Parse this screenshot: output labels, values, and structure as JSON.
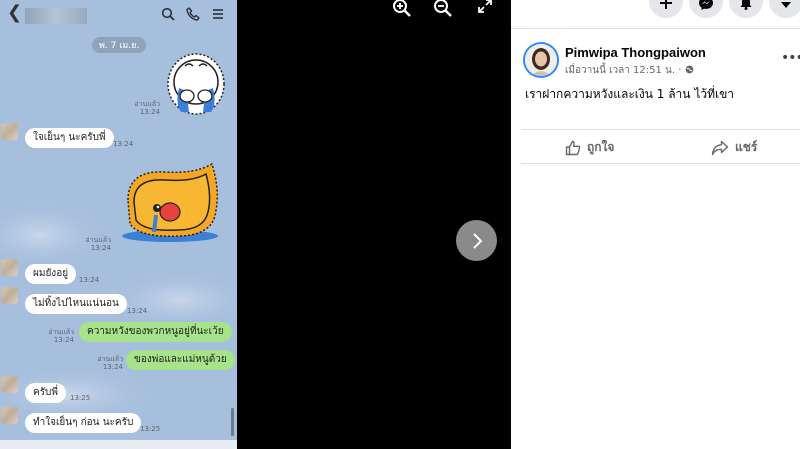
{
  "chat": {
    "date_pill": "พ. 7 เม.ย.",
    "messages": [
      {
        "side": "right",
        "kind": "sticker",
        "read": "อ่านแล้ว",
        "time": "13:24"
      },
      {
        "side": "left",
        "kind": "text",
        "text": "ใจเย็นๆ นะครับพี่",
        "time": "13:24"
      },
      {
        "side": "right",
        "kind": "sticker",
        "read": "อ่านแล้ว",
        "time": "13:24"
      },
      {
        "side": "left",
        "kind": "text",
        "text": "ผมยังอยู่",
        "time": "13:24"
      },
      {
        "side": "left",
        "kind": "text",
        "text": "ไม่ทิ้งไปไหนแน่นอน",
        "time": "13:24"
      },
      {
        "side": "right",
        "kind": "text",
        "text": "ความหวังของพวกหนูอยู่ที่นะเว้ย",
        "read": "อ่านแล้ว",
        "time": "13:24"
      },
      {
        "side": "right",
        "kind": "text",
        "text": "ของพ่อและแม่หนูด้วย",
        "read": "อ่านแล้ว",
        "time": "13:24"
      },
      {
        "side": "left",
        "kind": "text",
        "text": "ครับพี่",
        "time": "13:25"
      },
      {
        "side": "left",
        "kind": "text",
        "text": "ทำใจเย็นๆ ก่อน นะครับ",
        "time": "13:25"
      }
    ],
    "icons": [
      "back-icon",
      "search-icon",
      "phone-icon",
      "menu-icon"
    ]
  },
  "viewer": {
    "icons": [
      "zoom-in-icon",
      "zoom-out-icon",
      "fullscreen-icon",
      "next-arrow-icon"
    ]
  },
  "post": {
    "author": "Pimwipa Thongpaiwon",
    "timestamp": "เมื่อวานนี้ เวลา 12:51 น. ·",
    "text": "เราฝากความหวังและเงิน 1 ล้าน ไว้ที่เขา",
    "like_label": "ถูกใจ",
    "share_label": "แชร์",
    "accent": "#2d88ff"
  }
}
